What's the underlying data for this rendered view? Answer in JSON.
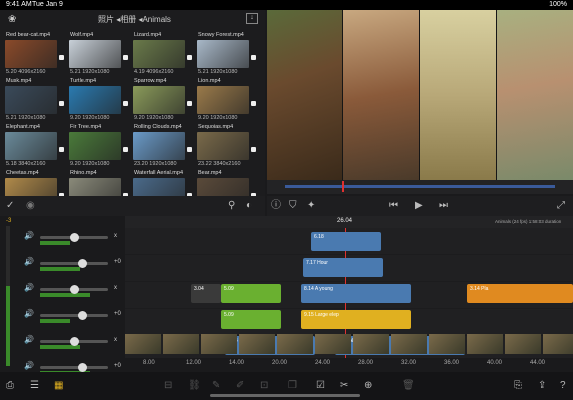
{
  "status": {
    "time": "9:41 AM",
    "date": "Tue Jan 9",
    "battery": "100%"
  },
  "browser": {
    "breadcrumb": "照片 ◂相册 ◂Animals",
    "clips": [
      {
        "name": "Red bear-cat.mp4",
        "meta": "5.20  4096x2160",
        "color": "#8a4a2a"
      },
      {
        "name": "Wolf.mp4",
        "meta": "5.21  1920x1080",
        "color": "#c8d0d8"
      },
      {
        "name": "Lizard.mp4",
        "meta": "4.19  4096x2160",
        "color": "#6a7a4a"
      },
      {
        "name": "Snowy Forest.mp4",
        "meta": "5.21  1920x1080",
        "color": "#a8b8c8"
      },
      {
        "name": "Musk.mp4",
        "meta": "5.21  1920x1080",
        "color": "#3a4a5a"
      },
      {
        "name": "Turtle.mp4",
        "meta": "9.20  1920x1080",
        "color": "#2a7ab0"
      },
      {
        "name": "Sparrow.mp4",
        "meta": "9.20  1920x1080",
        "color": "#8a9a5a"
      },
      {
        "name": "Lion.mp4",
        "meta": "9.20  1920x1080",
        "color": "#9a7a4a"
      },
      {
        "name": "Elephant.mp4",
        "meta": "5.18  3840x2160",
        "color": "#6a8a9a"
      },
      {
        "name": "Fir Tree.mp4",
        "meta": "9.20  1920x1080",
        "color": "#4a7a3a"
      },
      {
        "name": "Rolling Clouds.mp4",
        "meta": "23.20  1920x1080",
        "color": "#6a9ac8"
      },
      {
        "name": "Sequoias.mp4",
        "meta": "23.22  3840x2160",
        "color": "#7a6a4a"
      },
      {
        "name": "Cheetas.mp4",
        "meta": "",
        "color": "#b08a4a"
      },
      {
        "name": "Rhino.mp4",
        "meta": "",
        "color": "#8a8a7a"
      },
      {
        "name": "Waterfall Aerial.mp4",
        "meta": "",
        "color": "#4a6a8a"
      },
      {
        "name": "Bear.mp4",
        "meta": "",
        "color": "#5a4a3a"
      }
    ]
  },
  "viewer": {
    "panels": [
      "#6a4a2e",
      "#8a5a3a",
      "#b8a878",
      "#7a8a6a"
    ]
  },
  "timeline": {
    "current_time": "26.04",
    "project_info": "Animals (24 fps)  1:58:03 duration",
    "ticks": [
      "8.00",
      "12.00",
      "14.00",
      "20.00",
      "24.00",
      "28.00",
      "32.00",
      "36.00",
      "40.00",
      "44.00",
      "48.00"
    ],
    "clips": [
      {
        "label": "6.18",
        "color": "#4a7ab0",
        "row": 0
      },
      {
        "label": "7.17  Hour",
        "color": "#4a7ab0",
        "row": 1
      },
      {
        "label": "3.04",
        "color": "#3a3a3a",
        "row": 2
      },
      {
        "label": "5.09",
        "color": "#6ab030",
        "row": 2
      },
      {
        "label": "8.14  A young",
        "color": "#4a7ab0",
        "row": 2
      },
      {
        "label": "3.14  Pla",
        "color": "#e08a20",
        "row": 2
      },
      {
        "label": "5.09",
        "color": "#6ab030",
        "row": 3
      },
      {
        "label": "9.15  Large elep",
        "color": "#e0b020",
        "row": 3
      },
      {
        "label": "5.14  Bear layers",
        "color": "#4a7ab0",
        "row": 4
      },
      {
        "label": "9.03  AERIAL",
        "color": "#4a7ab0",
        "row": 4
      }
    ],
    "track_levels": [
      "x",
      "+0",
      "x",
      "+0",
      "x",
      "+0"
    ]
  }
}
